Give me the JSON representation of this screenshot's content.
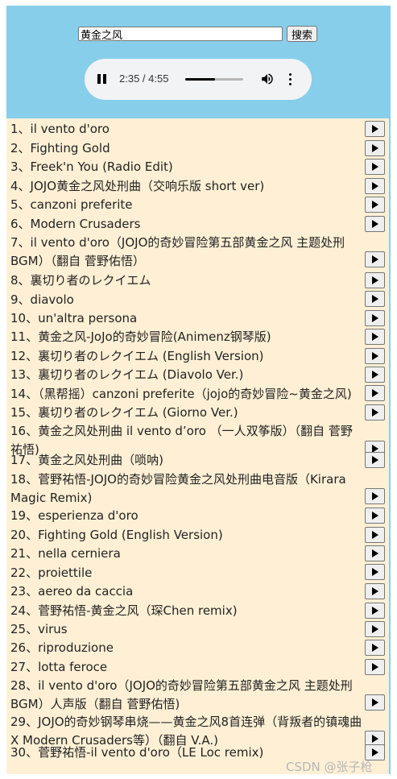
{
  "search": {
    "value": "黄金之风",
    "button_label": "搜索"
  },
  "player": {
    "time": "2:35 / 4:55",
    "progress": 0.52
  },
  "songs": [
    "1、il vento d'oro",
    "2、Fighting Gold",
    "3、Freek'n You (Radio Edit)",
    "4、JOJO黄金之风处刑曲（交响乐版 short ver)",
    "5、canzoni preferite",
    "6、Modern Crusaders",
    "7、il vento d'oro（JOJO的奇妙冒险第五部黄金之风 主题处刑BGM）（翻自 菅野佑悟）",
    "8、裏切り者のレクイエム",
    "9、diavolo",
    "10、un'altra persona",
    "11、黄金之风-JoJo的奇妙冒险(Animenz钢琴版)",
    "12、裏切り者のレクイエム (English Version)",
    "13、裏切り者のレクイエム (Diavolo Ver.)",
    "14、（黑帮摇）canzoni preferite（jojo的奇妙冒险~黄金之风)",
    "15、裏切り者のレクイエム (Giorno Ver.)",
    "16、黄金之风处刑曲 il vento d’oro （一人双筝版）（翻自 菅野祐悟)",
    "17、黄金之风处刑曲（唢呐)",
    "18、菅野祐悟-JOJO的奇妙冒险黄金之风处刑曲电音版（Kirara Magic Remix)",
    "19、esperienza d'oro",
    "20、Fighting Gold (English Version)",
    "21、nella cerniera",
    "22、proiettile",
    "23、aereo da caccia",
    "24、菅野祐悟-黄金之风（琛Chen remix)",
    "25、virus",
    "26、riproduzione",
    "27、lotta feroce",
    "28、il vento d'oro（JOJO的奇妙冒险第五部黄金之风 主题处刑BGM）人声版（翻自 菅野佑悟)",
    "29、JOJO的奇妙钢琴串烧——黄金之风8首连弹（背叛者的镇魂曲 X Modern Crusaders等）（翻自 V.A.)",
    "30、菅野祐悟-il vento d'oro（LE Loc remix)"
  ],
  "watermark": "CSDN @张子枪"
}
